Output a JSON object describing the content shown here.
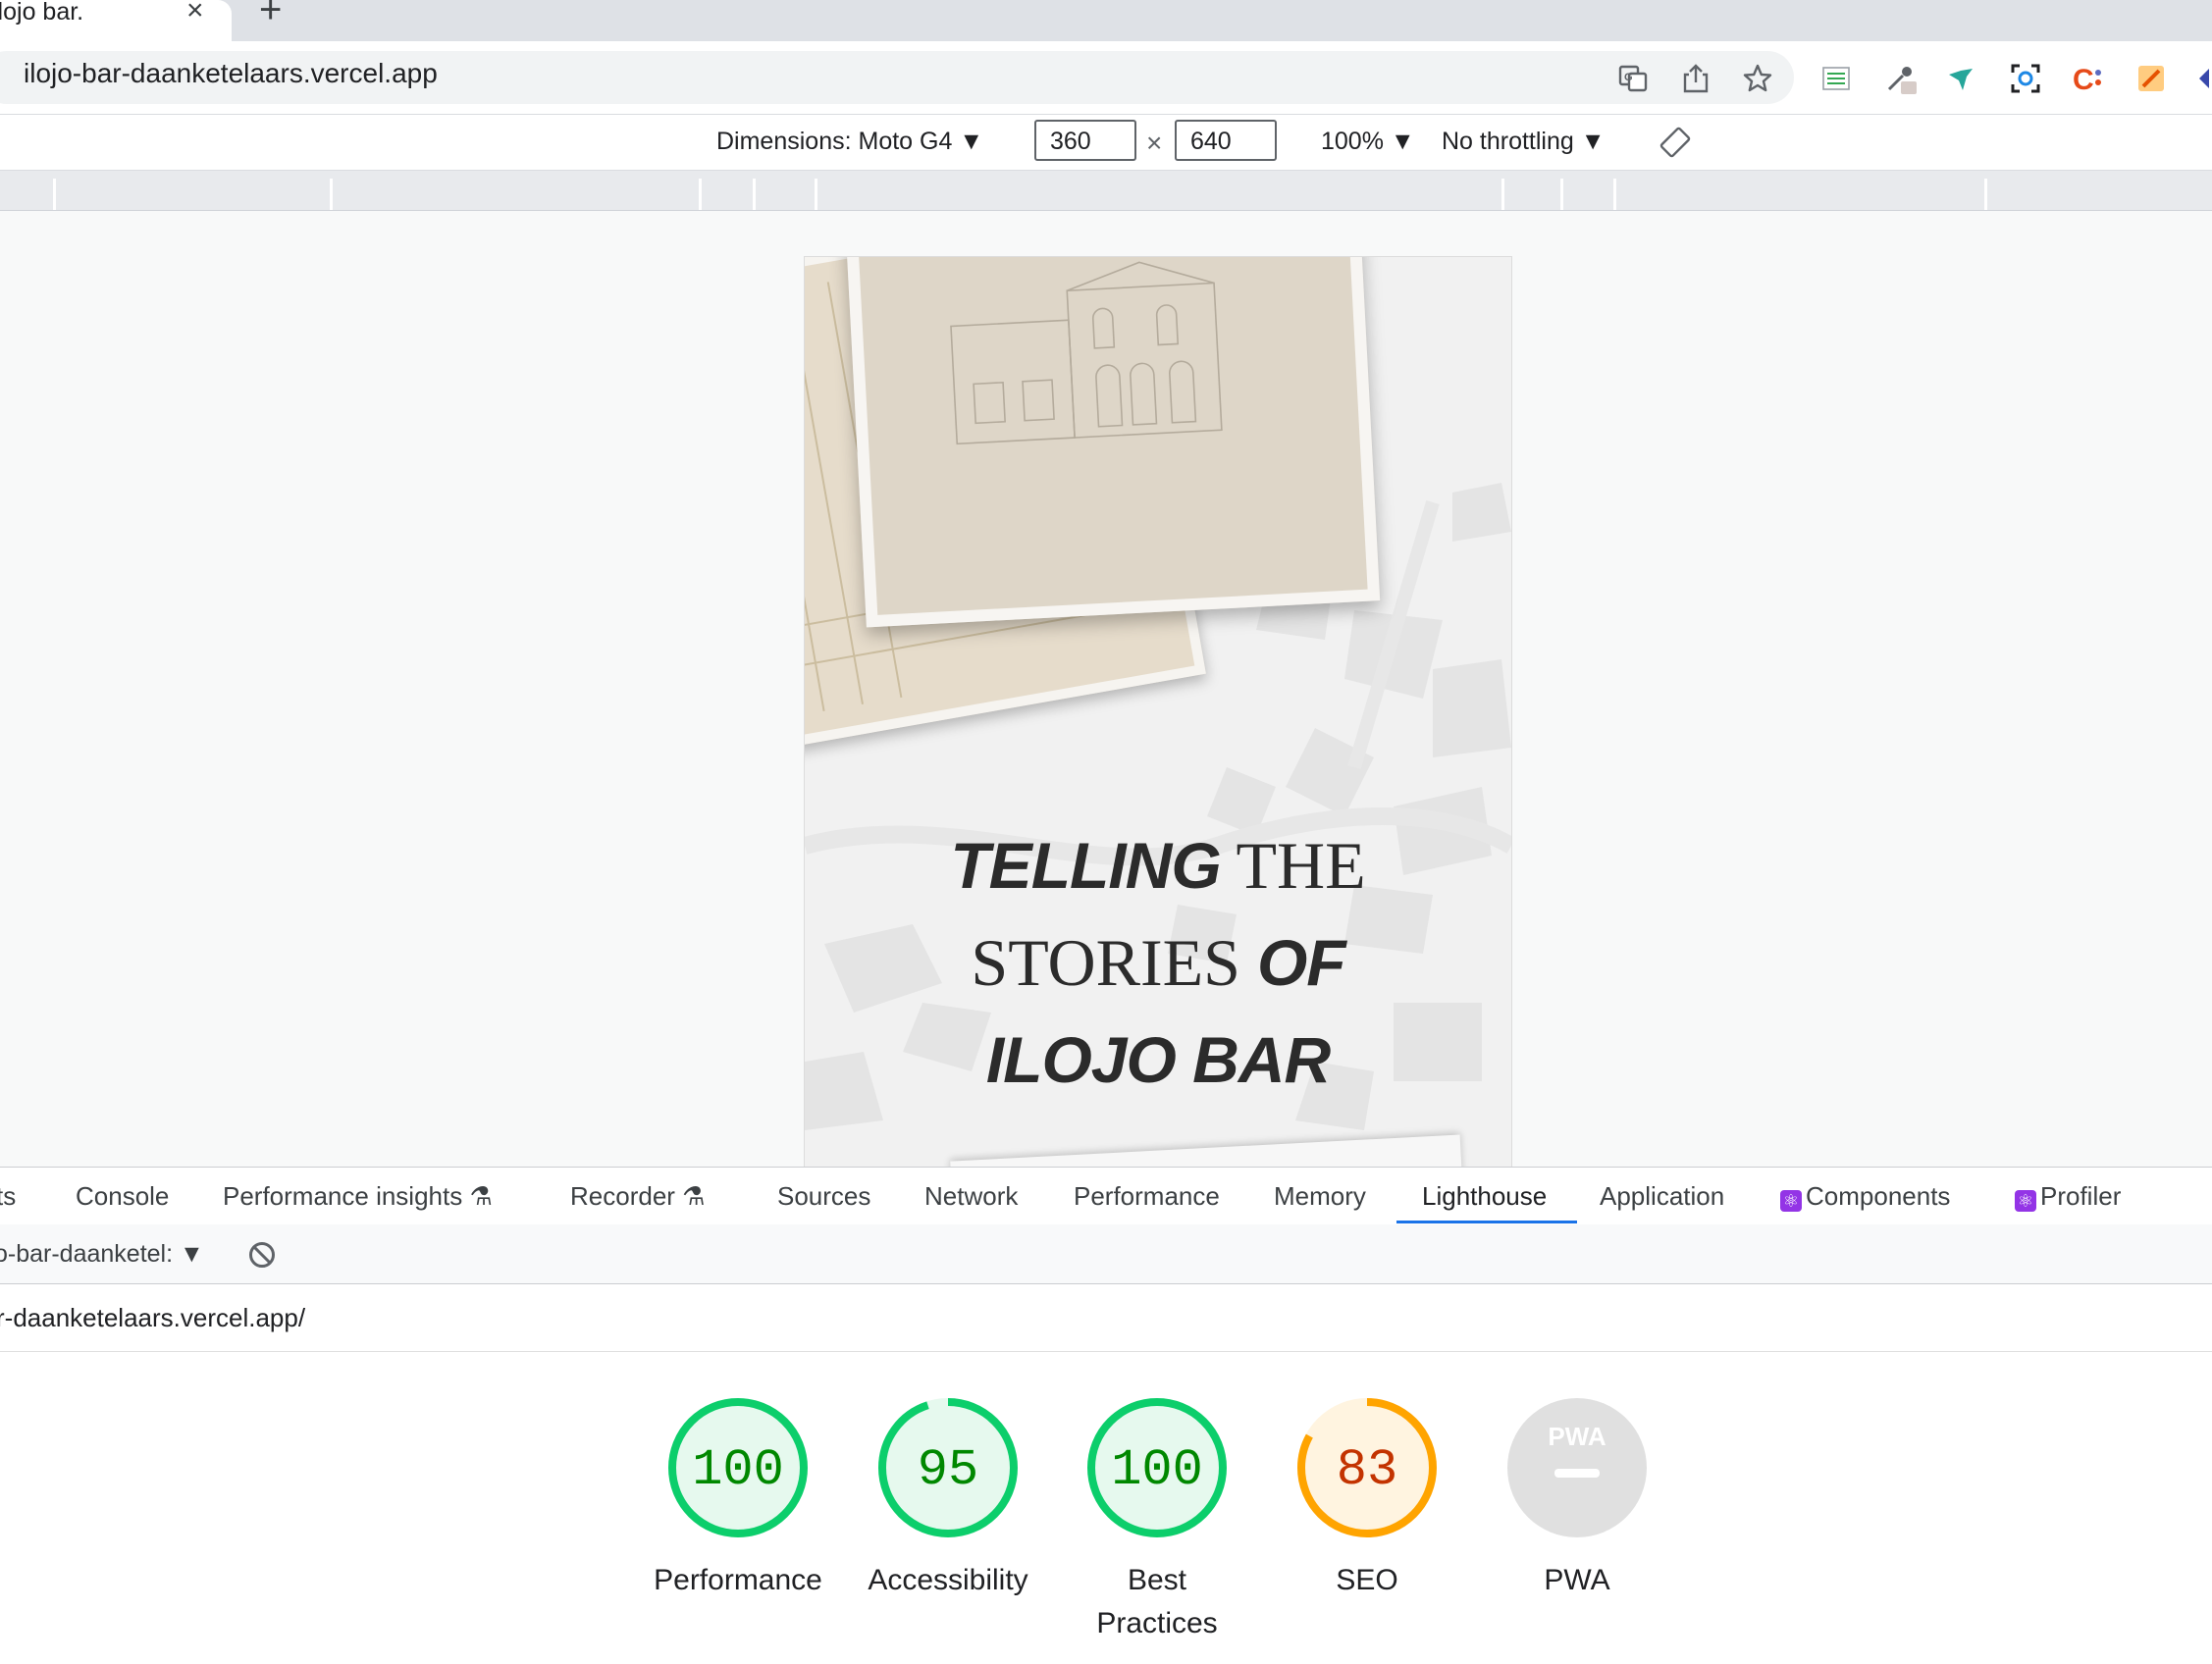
{
  "browser": {
    "tab_title": "ilojo bar.",
    "tab_close": "×",
    "new_tab": "+",
    "url": "ilojo-bar-daanketelaars.vercel.app",
    "extension_icons": [
      "translate-icon",
      "share-icon",
      "star-icon",
      "sheets-ext-icon",
      "eyedropper-ext-icon",
      "bird-ext-icon",
      "screenshot-ext-icon",
      "c-ext-icon",
      "highlighter-ext-icon"
    ]
  },
  "device_toolbar": {
    "dimensions_label": "Dimensions: Moto G4 ▼",
    "width": "360",
    "height": "640",
    "separator": "×",
    "zoom": "100% ▼",
    "throttling": "No throttling ▼"
  },
  "page": {
    "hero_line1_bold": "TELLING",
    "hero_line1_serif": " THE",
    "hero_line2_serif": "STORIES ",
    "hero_line2_bold": "OF",
    "hero_line3_bold": "ILOJO BAR"
  },
  "devtools": {
    "tabs": [
      {
        "label": "ts"
      },
      {
        "label": "Console"
      },
      {
        "label": "Performance insights ⚗"
      },
      {
        "label": "Recorder ⚗"
      },
      {
        "label": "Sources"
      },
      {
        "label": "Network"
      },
      {
        "label": "Performance"
      },
      {
        "label": "Memory"
      },
      {
        "label": "Lighthouse"
      },
      {
        "label": "Application"
      },
      {
        "label": "Components"
      },
      {
        "label": "Profiler"
      }
    ],
    "active_tab": "Lighthouse",
    "report_select": "o-bar-daanketel: ▼",
    "report_url": "r-daanketelaars.vercel.app/"
  },
  "lighthouse": {
    "colors": {
      "pass": "#0cce6b",
      "pass_text": "#008800",
      "average": "#ffa400",
      "average_text": "#c33300",
      "na": "#e0e0e0"
    },
    "scores": [
      {
        "label": "Performance",
        "score": "100",
        "value": 100,
        "rating": "pass"
      },
      {
        "label": "Accessibility",
        "score": "95",
        "value": 95,
        "rating": "pass"
      },
      {
        "label": "Best Practices",
        "score": "100",
        "value": 100,
        "rating": "pass"
      },
      {
        "label": "SEO",
        "score": "83",
        "value": 83,
        "rating": "average"
      },
      {
        "label": "PWA",
        "score": "PWA",
        "value": null,
        "rating": "na"
      }
    ]
  }
}
